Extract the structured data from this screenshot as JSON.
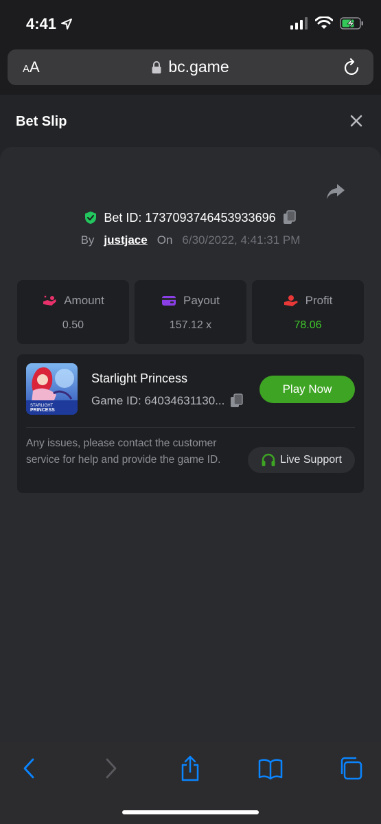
{
  "status_bar": {
    "time": "4:41",
    "icons": [
      "location-arrow-icon",
      "signal-icon",
      "wifi-icon",
      "battery-charging-icon"
    ]
  },
  "browser": {
    "text_size_small": "A",
    "text_size_large": "A",
    "url": "bc.game",
    "icons": [
      "lock-icon",
      "reload-icon"
    ]
  },
  "header": {
    "title": "Bet Slip"
  },
  "bet": {
    "id_text": "Bet ID: 1737093746453933696",
    "by_label": "By",
    "username": "justjace",
    "on_label": "On",
    "datetime": "6/30/2022, 4:41:31 PM"
  },
  "stats": [
    {
      "label": "Amount",
      "value": "0.50",
      "color": "#e8316a",
      "icon": "coins-hand-icon"
    },
    {
      "label": "Payout",
      "value": "157.12 x",
      "color": "#8a3ee6",
      "icon": "wallet-icon"
    },
    {
      "label": "Profit",
      "value": "78.06",
      "color": "#e83838",
      "icon": "hand-money-icon"
    }
  ],
  "game": {
    "name": "Starlight Princess",
    "id_text": "Game ID: 64034631130...",
    "thumb_text_1": "STARLIGHT",
    "thumb_text_2": "PRINCESS",
    "play_label": "Play Now",
    "help_text": "Any issues, please contact the customer service for help and provide the game ID.",
    "support_label": "Live Support"
  },
  "colors": {
    "accent_green": "#3ea423",
    "profit_green": "#3fc92b",
    "ios_blue": "#0a84ff",
    "shield_green": "#22c55e"
  }
}
